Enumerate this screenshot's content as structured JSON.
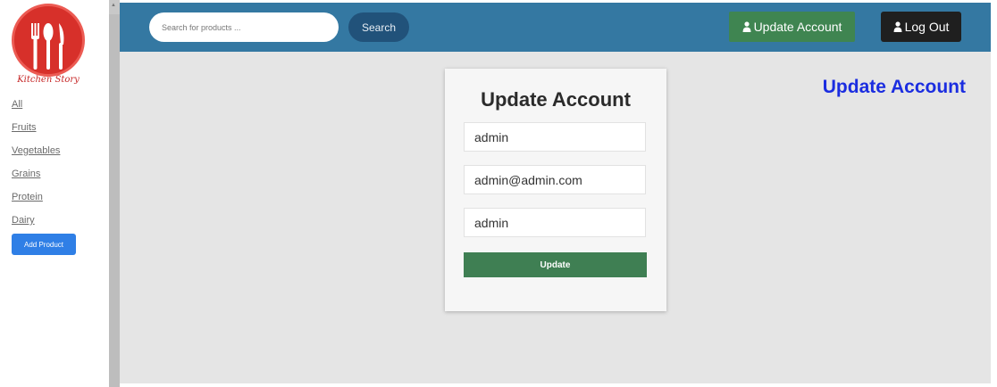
{
  "brand": {
    "logo_text": "Kitchen Story",
    "logo_color": "#d7302a"
  },
  "sidebar": {
    "categories": [
      "All",
      "Fruits",
      "Vegetables",
      "Grains",
      "Protein",
      "Dairy"
    ],
    "add_product_label": "Add Product"
  },
  "topbar": {
    "search_placeholder": "Search for products ...",
    "search_label": "Search",
    "update_account_label": "Update Account",
    "logout_label": "Log Out",
    "background": "#3478a2"
  },
  "page": {
    "heading": "Update Account",
    "heading_color": "#1b2de0"
  },
  "form": {
    "title": "Update Account",
    "username_value": "admin",
    "email_value": "admin@admin.com",
    "password_value": "admin",
    "submit_label": "Update"
  }
}
